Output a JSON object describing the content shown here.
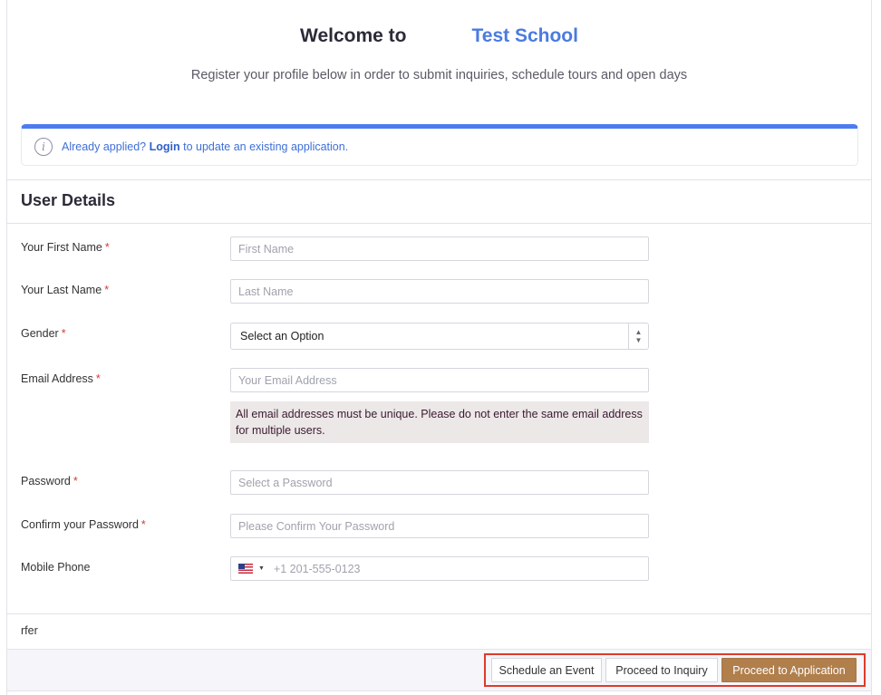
{
  "header": {
    "welcome": "Welcome to",
    "school_name": "Test School",
    "subtitle": "Register your profile below in order to submit inquiries, schedule tours and open days"
  },
  "alert": {
    "prefix": "Already applied?",
    "link": "Login",
    "suffix": "to update an existing application."
  },
  "section": {
    "title": "User Details"
  },
  "fields": {
    "first_name": {
      "label": "Your First Name",
      "required": "*",
      "placeholder": "First Name"
    },
    "last_name": {
      "label": "Your Last Name",
      "required": "*",
      "placeholder": "Last Name"
    },
    "gender": {
      "label": "Gender",
      "required": "*",
      "value": "Select an Option"
    },
    "email": {
      "label": "Email Address",
      "required": "*",
      "placeholder": "Your Email Address",
      "note": "All email addresses must be unique. Please do not enter the same email address for multiple users."
    },
    "password": {
      "label": "Password",
      "required": "*",
      "placeholder": "Select a Password"
    },
    "confirm_password": {
      "label": "Confirm your Password",
      "required": "*",
      "placeholder": "Please Confirm Your Password"
    },
    "mobile": {
      "label": "Mobile Phone",
      "placeholder": "+1 201-555-0123"
    }
  },
  "footer": {
    "text": "rfer"
  },
  "actions": {
    "schedule": "Schedule an Event",
    "inquiry": "Proceed to Inquiry",
    "application": "Proceed to Application"
  },
  "colors": {
    "accent": "#4e7cf0",
    "primary_button": "#b07f4c",
    "highlight_border": "#e03a2a"
  }
}
